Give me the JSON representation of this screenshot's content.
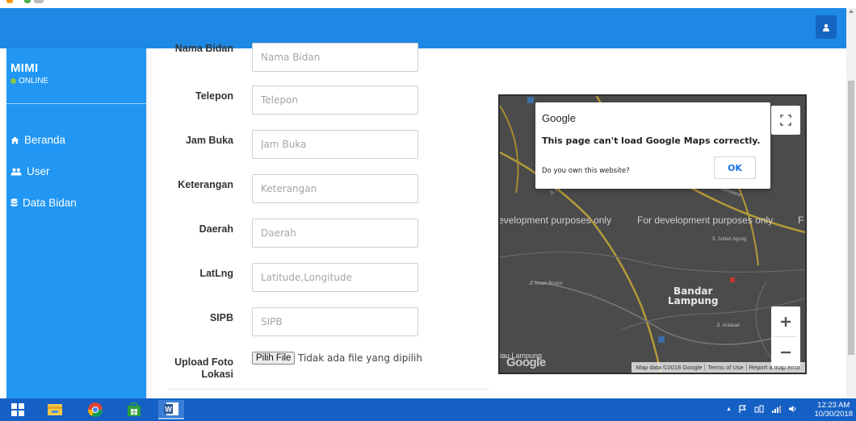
{
  "sidebar": {
    "brand_name": "MIMI",
    "status": "ONLINE",
    "items": [
      {
        "label": "Beranda",
        "icon": "home-icon"
      },
      {
        "label": "User",
        "icon": "users-icon"
      },
      {
        "label": "Data Bidan",
        "icon": "database-icon"
      }
    ]
  },
  "form": {
    "fields": [
      {
        "label": "Nama Bidan",
        "placeholder": "Nama Bidan"
      },
      {
        "label": "Telepon",
        "placeholder": "Telepon"
      },
      {
        "label": "Jam Buka",
        "placeholder": "Jam Buka"
      },
      {
        "label": "Keterangan",
        "placeholder": "Keterangan"
      },
      {
        "label": "Daerah",
        "placeholder": "Daerah"
      },
      {
        "label": "LatLng",
        "placeholder": "Latitude,Longitude"
      },
      {
        "label": "SIPB",
        "placeholder": "SIPB"
      }
    ],
    "upload": {
      "label_line1": "Upload Foto",
      "label_line2": "Lokasi",
      "button": "Pilih File",
      "status": "Tidak ada file yang dipilih"
    }
  },
  "map": {
    "dialog": {
      "title": "Google",
      "message": "This page can't load Google Maps correctly.",
      "question": "Do you own this website?",
      "ok": "OK"
    },
    "watermark": "For development purposes only",
    "watermark_left": "evelopment purposes only",
    "watermark_right": "F",
    "city_line1": "Bandar",
    "city_line2": "Lampung",
    "place_left": "iau Lampung",
    "logo": "Google",
    "attribution": [
      "Map data ©2018 Google",
      "Terms of Use",
      "Report a map error"
    ]
  },
  "taskbar": {
    "apps": [
      "windows-start-icon",
      "file-explorer-icon",
      "chrome-icon",
      "store-icon",
      "word-icon"
    ],
    "time": "12:23 AM",
    "date": "10/30/2018"
  },
  "colors": {
    "navbar": "#1e88e5",
    "sidebar": "#2196f3",
    "taskbar": "#1560c5",
    "map": "#4b4b4b",
    "road": "#b59a3a"
  }
}
